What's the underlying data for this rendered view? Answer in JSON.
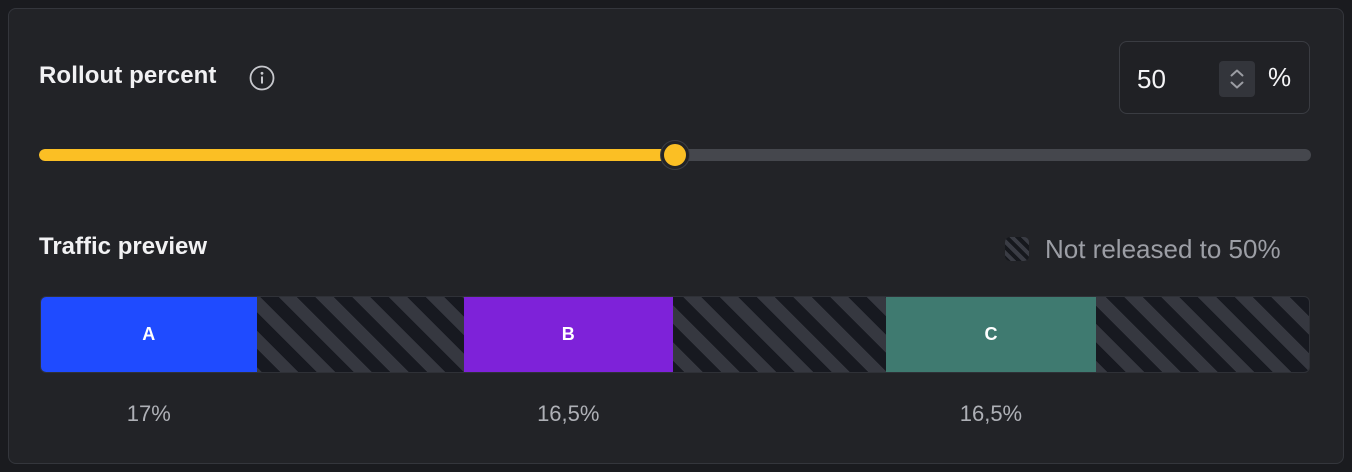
{
  "rollout": {
    "label": "Rollout percent",
    "value": "50",
    "suffix": "%",
    "level": 0.5,
    "accent_color": "#fbbf24",
    "info_icon": "info-circle-icon",
    "stepper_icon": "chevron-up-down-icon"
  },
  "traffic": {
    "label": "Traffic preview",
    "legend": "Not released to 50%",
    "legend_icon": "hatched-swatch-icon",
    "variants": [
      {
        "name": "A",
        "share": "17%",
        "color": "#1f4bff"
      },
      {
        "name": "B",
        "share": "16,5%",
        "color": "#7e22d9"
      },
      {
        "name": "C",
        "share": "16,5%",
        "color": "#3f7a70"
      }
    ],
    "slots": 3
  }
}
